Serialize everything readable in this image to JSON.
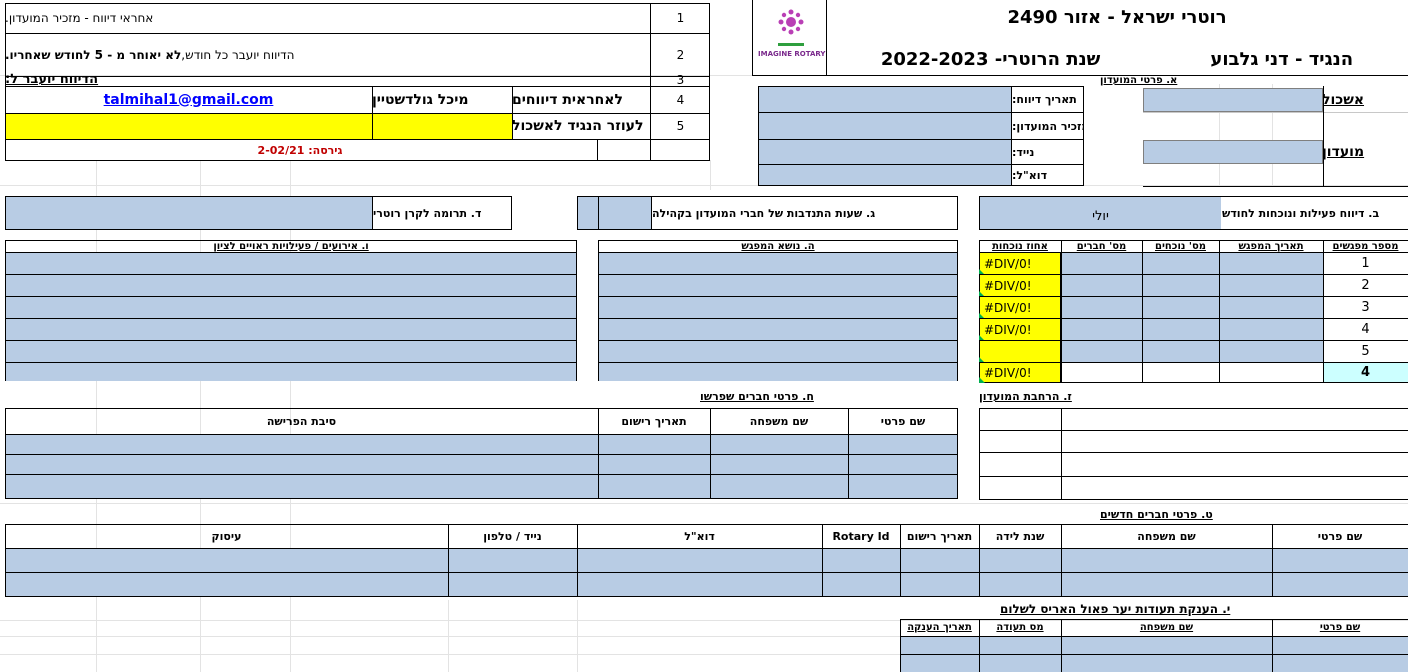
{
  "header": {
    "title": "רוטרי ישראל - אזור 2490",
    "governor": "הנגיד - דני גלבוע",
    "rotary_year": "שנת הרוטרי- 2022-2023",
    "logo_text": "IMAGINE ROTARY"
  },
  "instructions": {
    "row1_num": "1",
    "row1_text": "אחראי דיווח - מזכיר המועדון.",
    "row2_num": "2",
    "row2_text_a": "הדיווח יועבר כל חודש, ",
    "row2_text_b": "לא יאוחר מ - 5 לחודש שאחריו.",
    "row3_num": "3",
    "row3_text": "הדיווח יועבר ל:",
    "row4_num": "4",
    "row4_label": "לאחראית דיווחים",
    "row4_name": "מיכל גולדשטיין",
    "row4_email": "talmihal1@gmail.com",
    "row5_num": "5",
    "row5_label": "לעוזר הנגיד לאשכול",
    "version": "גירסה: 2-02/21"
  },
  "section_a": {
    "title": "א. פרטי המועדון",
    "cluster_label": "אשכול",
    "club_label": "מועדון",
    "report_date_label": "תאריך דיווח:",
    "secretary_label": "מזכיר המועדון:",
    "mobile_label": "נייד:",
    "email_label": "דוא\"ל:"
  },
  "section_b": {
    "title": "ב. דיווח פעילות ונוכחות לחודש",
    "month_value": "יולי",
    "headers": [
      "מספר מפגשים",
      "תאריך המפגש",
      "מס' נוכחים",
      "מס' חברים",
      "אחוז נוכחות"
    ],
    "rows": [
      {
        "num": "1",
        "pct": "#DIV/0!"
      },
      {
        "num": "2",
        "pct": "#DIV/0!"
      },
      {
        "num": "3",
        "pct": "#DIV/0!"
      },
      {
        "num": "4",
        "pct": "#DIV/0!"
      },
      {
        "num": "5",
        "pct": ""
      }
    ],
    "total_num": "4",
    "total_pct": "#DIV/0!"
  },
  "section_g": {
    "title": "ג. שעות התנדבות של חברי המועדון בקהילה"
  },
  "section_d": {
    "title": "ד. תרומה לקרן רוטרי"
  },
  "section_h": {
    "title": "ה. נושא המפגש"
  },
  "section_v": {
    "title": "ו. אירועים / פעילויות ראויים לציון"
  },
  "section_z": {
    "title": "ז. הרחבת המועדון"
  },
  "section_ch": {
    "title": "ח. פרטי חברים שפרשו",
    "headers": [
      "שם פרטי",
      "שם משפחה",
      "תאריך רישום",
      "סיבת הפרישה"
    ]
  },
  "section_t": {
    "title": "ט. פרטי חברים חדשים",
    "headers": [
      "שם פרטי",
      "שם משפחה",
      "שנת לידה",
      "תאריך רישום",
      "Rotary Id",
      "דוא\"ל",
      "נייד / טלפון",
      "עיסוק"
    ]
  },
  "section_y": {
    "title": "י. הענקת תעודות יער פאול האריס לשלום",
    "headers": [
      "שם פרטי",
      "שם משפחה",
      "מס תעודה",
      "תאריך הענקה"
    ]
  },
  "colors": {
    "input": "#b8cce4",
    "highlight": "#ffff00",
    "total": "#ccffff",
    "email": "#0000ff",
    "version": "#c00000"
  }
}
